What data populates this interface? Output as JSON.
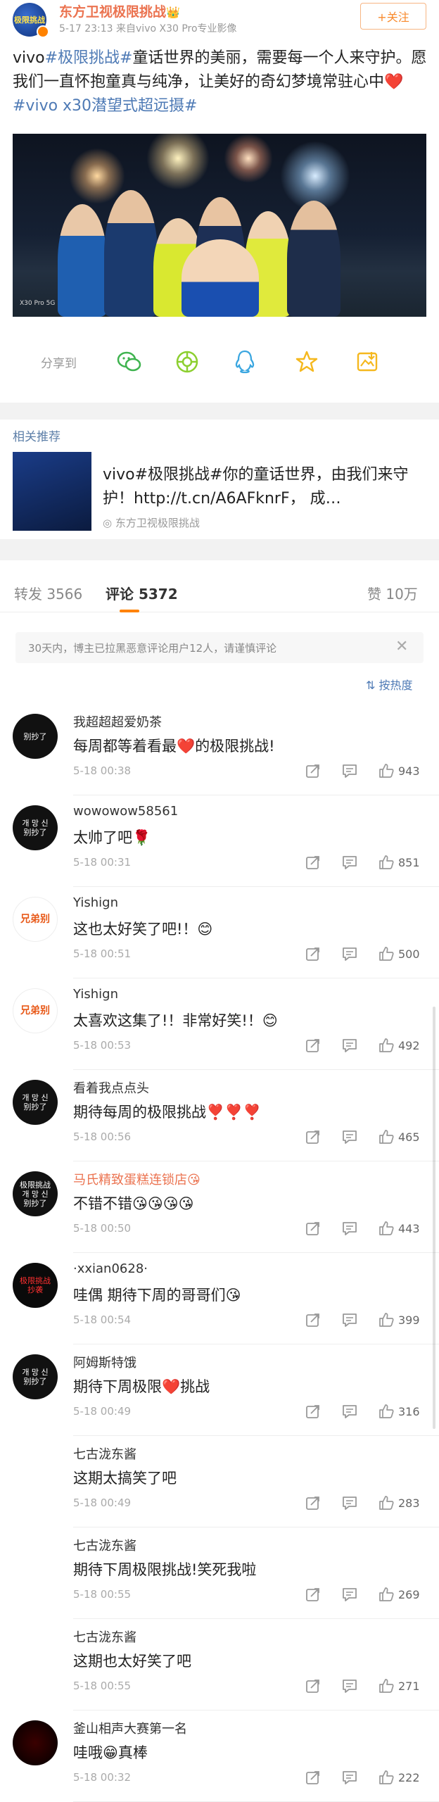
{
  "post": {
    "author": "东方卫视极限挑战",
    "author_crown": "👑",
    "avatar_text": "极限挑战",
    "meta": "5-17 23:13  来自vivo X30 Pro专业影像",
    "follow_label": "+关注",
    "text_parts": [
      {
        "text": "vivo",
        "tag": false
      },
      {
        "text": "#极限挑战#",
        "tag": true
      },
      {
        "text": "童话世界的美丽，需要每一个人来守护。愿我们一直怀抱童真与纯净，让美好的奇幻梦境常驻心中",
        "tag": false
      },
      {
        "text": "❤️",
        "tag": false
      },
      {
        "text": " ",
        "tag": false
      },
      {
        "text": "#vivo x30潜望式超远摄#",
        "tag": true
      }
    ],
    "photo_watermark": "X30 Pro 5G"
  },
  "share": {
    "label": "分享到",
    "targets": [
      "wechat-icon",
      "moments-icon",
      "qq-icon",
      "qzone-icon",
      "save-icon"
    ]
  },
  "related": {
    "title": "相关推荐",
    "text": "vivo#极限挑战#你的童话世界，由我们来守护！http://t.cn/A6AFknrF， 成…",
    "source": "东方卫视极限挑战"
  },
  "tabs": {
    "repost": "转发 3566",
    "comments": "评论 5372",
    "likes": "赞 10万"
  },
  "notice": {
    "text": "30天内，博主已拉黑恶意评论用户12人，请谨慎评论",
    "close": "✕"
  },
  "sort_label": "按热度",
  "colors": {
    "brand_orange": "#ff8200",
    "link_blue": "#4e7ab5",
    "name_orange": "#eb7350"
  },
  "comments": [
    {
      "user": "我超超超爱奶茶",
      "text": "每周都等着看最❤️的极限挑战!",
      "time": "5-18 00:38",
      "likes": "943",
      "avatar_text": "别抄了"
    },
    {
      "user": "wowowow58561",
      "text": "太帅了吧🌹",
      "time": "5-18 00:31",
      "likes": "851",
      "avatar_text": "개 망 신\n别抄了"
    },
    {
      "user": "Yishign",
      "text": "这也太好笑了吧!！😊",
      "time": "5-18 00:51",
      "likes": "500",
      "avatar_text": "兄弟别"
    },
    {
      "user": "Yishign",
      "text": "太喜欢这集了!！非常好笑!！😊",
      "time": "5-18 00:53",
      "likes": "492",
      "avatar_text": "兄弟别"
    },
    {
      "user": "看着我点点头",
      "text": "期待每周的极限挑战❣️❣️❣️",
      "time": "5-18 00:56",
      "likes": "465",
      "avatar_text": "개 망 신\n别抄了"
    },
    {
      "user": "马氏精致蛋糕连锁店😘",
      "text": "不错不错😘😘😘😘",
      "time": "5-18 00:50",
      "likes": "443",
      "avatar_text": "极限挑战\n개 망 신\n别抄了"
    },
    {
      "user": "·xxian0628·",
      "text": "哇偶 期待下周的哥哥们😘",
      "time": "5-18 00:54",
      "likes": "399",
      "avatar_text": "极限挑战\n抄袭"
    },
    {
      "user": "阿姆斯特饿",
      "text": "期待下周极限❤️挑战",
      "time": "5-18 00:49",
      "likes": "316",
      "avatar_text": "개 망 신\n别抄了"
    },
    {
      "user": "七古泷东酱",
      "text": "这期太搞笑了吧",
      "time": "5-18 00:49",
      "likes": "283",
      "avatar_text": "😊"
    },
    {
      "user": "七古泷东酱",
      "text": "期待下周极限挑战!笑死我啦",
      "time": "5-18 00:55",
      "likes": "269",
      "avatar_text": "😊"
    },
    {
      "user": "七古泷东酱",
      "text": "这期也太好笑了吧",
      "time": "5-18 00:55",
      "likes": "271",
      "avatar_text": "😊"
    },
    {
      "user": "釜山相声大赛第一名",
      "text": "哇哦😁真棒",
      "time": "5-18 00:32",
      "likes": "222",
      "avatar_text": ""
    }
  ]
}
